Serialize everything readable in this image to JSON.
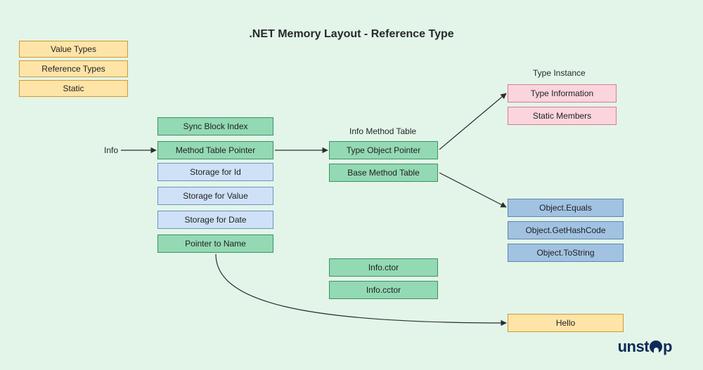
{
  "title": ".NET Memory Layout - Reference Type",
  "legend": {
    "value_types": "Value Types",
    "reference_types": "Reference Types",
    "static": "Static"
  },
  "info_label": "Info",
  "object_layout": {
    "sync_block": "Sync Block Index",
    "method_table_ptr": "Method Table Pointer",
    "storage_id": "Storage for Id",
    "storage_value": "Storage for Value",
    "storage_date": "Storage for Date",
    "pointer_name": "Pointer to Name"
  },
  "method_table": {
    "heading": "Info Method Table",
    "type_object_ptr": "Type Object Pointer",
    "base_method_table": "Base Method Table"
  },
  "type_instance": {
    "heading": "Type Instance",
    "type_information": "Type Information",
    "static_members": "Static Members"
  },
  "object_methods": {
    "equals": "Object.Equals",
    "gethashcode": "Object.GetHashCode",
    "tostring": "Object.ToString"
  },
  "ctors": {
    "ctor": "Info.ctor",
    "cctor": "Info.cctor"
  },
  "hello": "Hello",
  "logo": {
    "part1": "unst",
    "part2": "p"
  }
}
